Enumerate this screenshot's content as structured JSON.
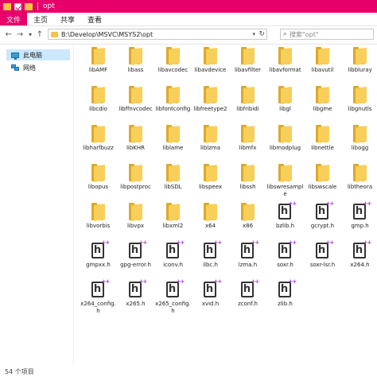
{
  "titlebar": {
    "title": "opt"
  },
  "ribbon": {
    "tabs": [
      "文件",
      "主页",
      "共享",
      "查看"
    ]
  },
  "address": {
    "back_glyph": "←",
    "forward_glyph": "→",
    "dropdown_glyph": "▾",
    "up_glyph": "↑",
    "path": "B:\\Develop\\MSVC\\MSYS2\\opt",
    "path_dropdown_glyph": "▾",
    "refresh_glyph": "↻",
    "search_glyph": "⌕",
    "search_placeholder": "搜索\"opt\""
  },
  "nav": {
    "items": [
      "此电脑",
      "网络"
    ]
  },
  "files": [
    {
      "name": "libAMF",
      "type": "folder"
    },
    {
      "name": "libass",
      "type": "folder"
    },
    {
      "name": "libavcodec",
      "type": "folder"
    },
    {
      "name": "libavdevice",
      "type": "folder"
    },
    {
      "name": "libavfilter",
      "type": "folder"
    },
    {
      "name": "libavformat",
      "type": "folder"
    },
    {
      "name": "libavutil",
      "type": "folder"
    },
    {
      "name": "libbluray",
      "type": "folder"
    },
    {
      "name": "libcdio",
      "type": "folder"
    },
    {
      "name": "libffnvcodec",
      "type": "folder"
    },
    {
      "name": "libfontconfig",
      "type": "folder"
    },
    {
      "name": "libfreetype2",
      "type": "folder"
    },
    {
      "name": "libfribidi",
      "type": "folder"
    },
    {
      "name": "libgl",
      "type": "folder"
    },
    {
      "name": "libgme",
      "type": "folder"
    },
    {
      "name": "libgnutls",
      "type": "folder"
    },
    {
      "name": "libharfbuzz",
      "type": "folder"
    },
    {
      "name": "libKHR",
      "type": "folder"
    },
    {
      "name": "liblame",
      "type": "folder"
    },
    {
      "name": "liblzma",
      "type": "folder"
    },
    {
      "name": "libmfx",
      "type": "folder"
    },
    {
      "name": "libmodplug",
      "type": "folder"
    },
    {
      "name": "libnettle",
      "type": "folder"
    },
    {
      "name": "libogg",
      "type": "folder"
    },
    {
      "name": "libopus",
      "type": "folder"
    },
    {
      "name": "libpostproc",
      "type": "folder"
    },
    {
      "name": "libSDL",
      "type": "folder"
    },
    {
      "name": "libspeex",
      "type": "folder"
    },
    {
      "name": "libssh",
      "type": "folder"
    },
    {
      "name": "libswresample",
      "type": "folder"
    },
    {
      "name": "libswscale",
      "type": "folder"
    },
    {
      "name": "libtheora",
      "type": "folder"
    },
    {
      "name": "libvorbis",
      "type": "folder"
    },
    {
      "name": "libvpx",
      "type": "folder"
    },
    {
      "name": "libxml2",
      "type": "folder"
    },
    {
      "name": "x64",
      "type": "folder"
    },
    {
      "name": "x86",
      "type": "folder"
    },
    {
      "name": "bzlib.h",
      "type": "header"
    },
    {
      "name": "gcrypt.h",
      "type": "header"
    },
    {
      "name": "gmp.h",
      "type": "header"
    },
    {
      "name": "gmpxx.h",
      "type": "header"
    },
    {
      "name": "gpg-error.h",
      "type": "header"
    },
    {
      "name": "iconv.h",
      "type": "header"
    },
    {
      "name": "ilbc.h",
      "type": "header"
    },
    {
      "name": "lzma.h",
      "type": "header"
    },
    {
      "name": "soxr.h",
      "type": "header"
    },
    {
      "name": "soxr-lsr.h",
      "type": "header"
    },
    {
      "name": "x264.h",
      "type": "header"
    },
    {
      "name": "x264_config.h",
      "type": "header"
    },
    {
      "name": "x265.h",
      "type": "header"
    },
    {
      "name": "x265_config.h",
      "type": "header"
    },
    {
      "name": "xvid.h",
      "type": "header"
    },
    {
      "name": "zconf.h",
      "type": "header"
    },
    {
      "name": "zlib.h",
      "type": "header"
    }
  ],
  "status": {
    "count": "54 个项目"
  },
  "colors": {
    "accent": "#e8006a",
    "folder": "#f8cf5a",
    "selection": "#cce8ff"
  },
  "icons": {
    "folder": "folder-icon",
    "header": "header-file-icon",
    "search": "search-icon"
  }
}
